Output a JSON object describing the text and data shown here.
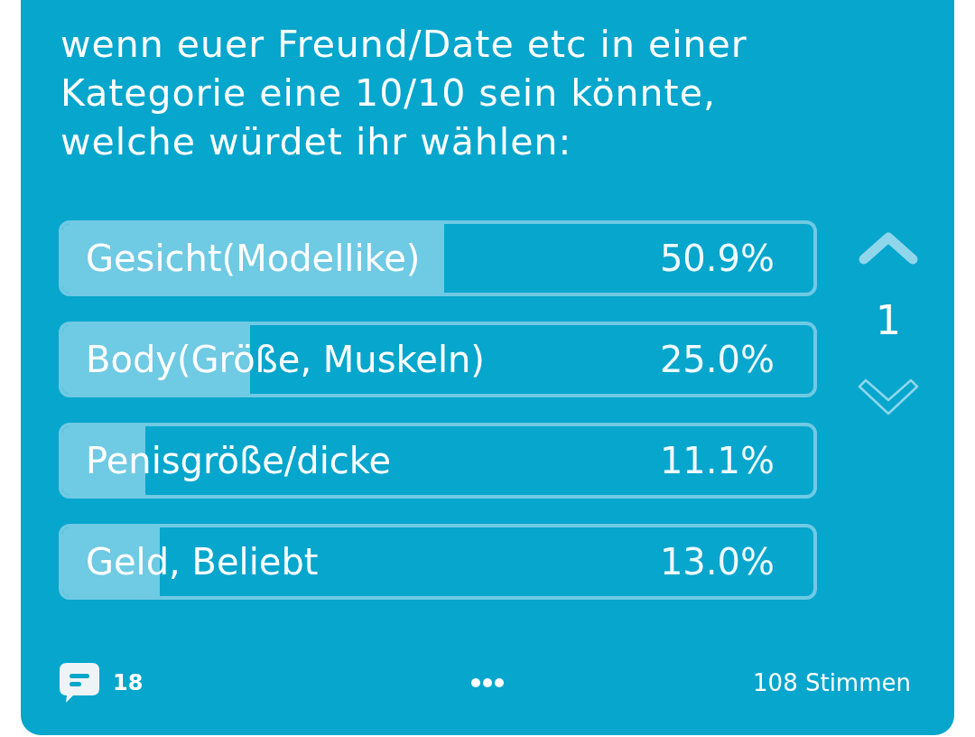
{
  "poll": {
    "question": "wenn euer Freund/Date etc in einer Kategorie eine 10/10 sein könnte, welche würdet ihr wählen:",
    "options": [
      {
        "label": "Gesicht(Modellike)",
        "percent": "50.9%",
        "level": 0.509
      },
      {
        "label": "Body(Größe, Muskeln)",
        "percent": "25.0%",
        "level": 0.25
      },
      {
        "label": "Penisgröße/dicke",
        "percent": "11.1%",
        "level": 0.111
      },
      {
        "label": "Geld, Beliebt",
        "percent": "13.0%",
        "level": 0.13
      }
    ],
    "score": "1"
  },
  "footer": {
    "comment_count": "18",
    "votes": "108 Stimmen"
  }
}
